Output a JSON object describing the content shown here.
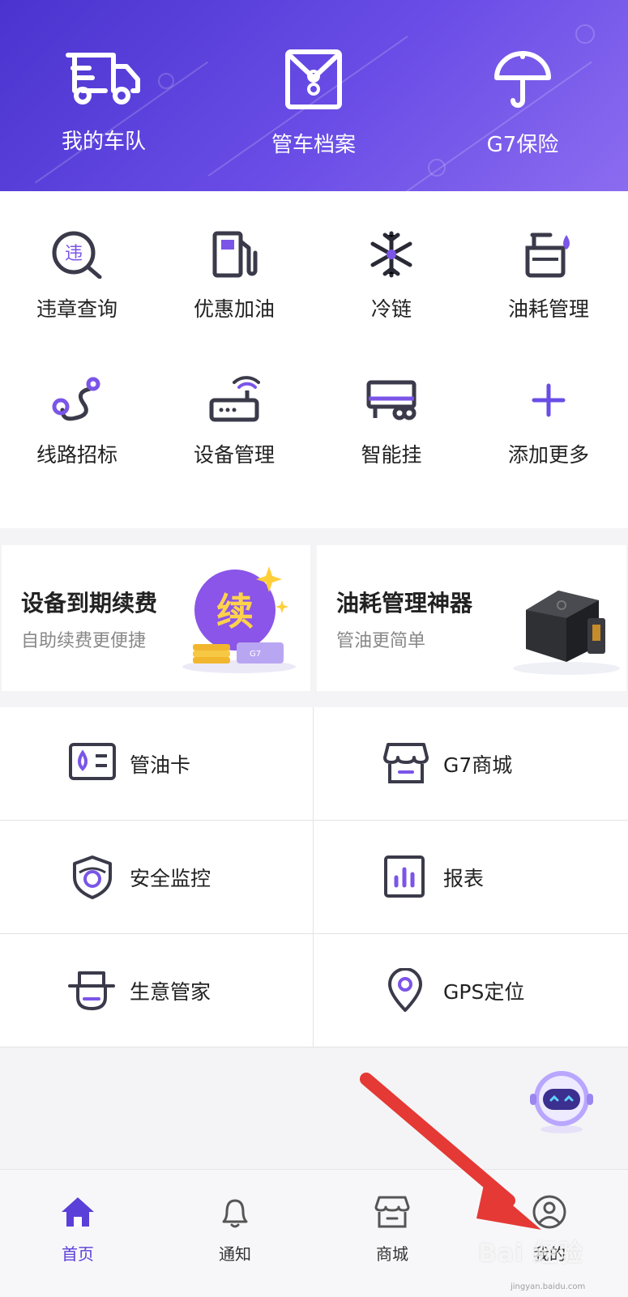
{
  "header": {
    "items": [
      {
        "label": "我的车队",
        "icon": "truck-icon"
      },
      {
        "label": "管车档案",
        "icon": "archive-envelope-icon"
      },
      {
        "label": "G7保险",
        "icon": "umbrella-icon"
      }
    ]
  },
  "quick": [
    {
      "label": "违章查询",
      "icon": "violation-search-icon",
      "glyph": "违"
    },
    {
      "label": "优惠加油",
      "icon": "fuel-pump-icon"
    },
    {
      "label": "冷链",
      "icon": "snowflake-icon"
    },
    {
      "label": "油耗管理",
      "icon": "fuel-consumption-icon"
    },
    {
      "label": "线路招标",
      "icon": "route-icon"
    },
    {
      "label": "设备管理",
      "icon": "router-device-icon"
    },
    {
      "label": "智能挂",
      "icon": "trailer-icon"
    },
    {
      "label": "添加更多",
      "icon": "plus-icon"
    }
  ],
  "cards": [
    {
      "title": "设备到期续费",
      "subtitle": "自助续费更便捷",
      "badge": "续",
      "device_tag": "G7"
    },
    {
      "title": "油耗管理神器",
      "subtitle": "管油更简单"
    }
  ],
  "menu": [
    {
      "label": "管油卡",
      "icon": "fuel-card-icon"
    },
    {
      "label": "G7商城",
      "icon": "store-icon"
    },
    {
      "label": "安全监控",
      "icon": "shield-camera-icon"
    },
    {
      "label": "报表",
      "icon": "report-chart-icon"
    },
    {
      "label": "生意管家",
      "icon": "butler-icon"
    },
    {
      "label": "GPS定位",
      "icon": "location-pin-icon"
    }
  ],
  "tabs": [
    {
      "label": "首页",
      "icon": "home-icon",
      "active": true
    },
    {
      "label": "通知",
      "icon": "bell-icon",
      "active": false
    },
    {
      "label": "商城",
      "icon": "store-icon",
      "active": false
    },
    {
      "label": "我的",
      "icon": "user-icon",
      "active": false
    }
  ],
  "watermark": {
    "text": "Bai 经验",
    "sub": "jingyan.baidu.com"
  },
  "colors": {
    "accent": "#5b3fd9",
    "header_start": "#4a33cf",
    "header_end": "#8b6cf0",
    "arrow": "#e53935",
    "icon_dark": "#3a3a4a"
  }
}
